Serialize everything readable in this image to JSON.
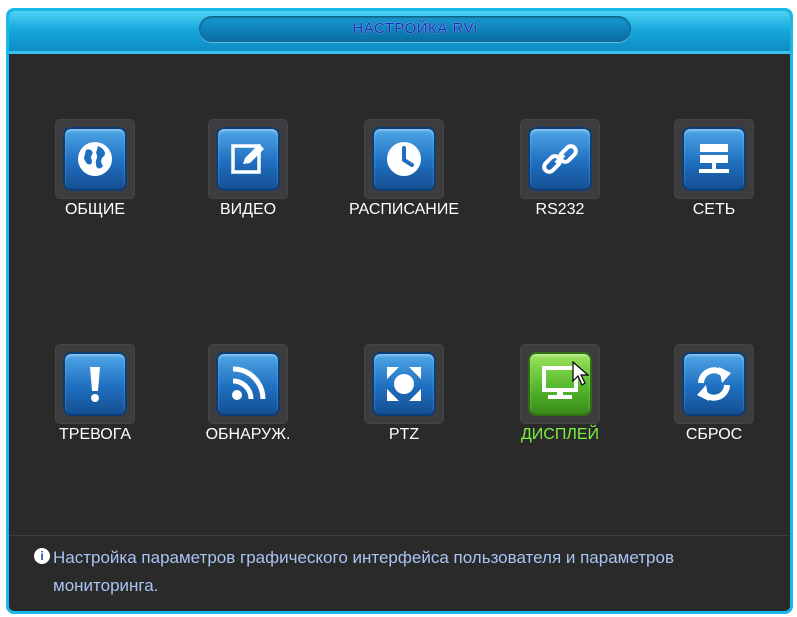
{
  "window": {
    "title": "НАСТРОЙКА RVi"
  },
  "menu": {
    "row1": [
      {
        "label": "ОБЩИЕ",
        "icon": "globe-icon"
      },
      {
        "label": "ВИДЕО",
        "icon": "edit-icon"
      },
      {
        "label": "РАСПИСАНИЕ",
        "icon": "clock-icon"
      },
      {
        "label": "RS232",
        "icon": "link-icon"
      },
      {
        "label": "СЕТЬ",
        "icon": "network-icon"
      }
    ],
    "row2": [
      {
        "label": "ТРЕВОГА",
        "icon": "alarm-icon"
      },
      {
        "label": "ОБНАРУЖ.",
        "icon": "rss-icon"
      },
      {
        "label": "PTZ",
        "icon": "ptz-icon"
      },
      {
        "label": "ДИСПЛЕЙ",
        "icon": "monitor-icon",
        "selected": true
      },
      {
        "label": "СБРОС",
        "icon": "refresh-icon"
      }
    ]
  },
  "status": {
    "icon": "info-icon",
    "text": "Настройка параметров графического интерфейса пользователя и параметров мониторинга."
  },
  "colors": {
    "frame": "#17b8e8",
    "background": "#2a2a2b",
    "icon_blue": "#1f6fc0",
    "icon_selected": "#55b92c",
    "label_selected": "#7df03d",
    "status_text": "#a8c4f2",
    "title_text": "#1b2bb8"
  }
}
